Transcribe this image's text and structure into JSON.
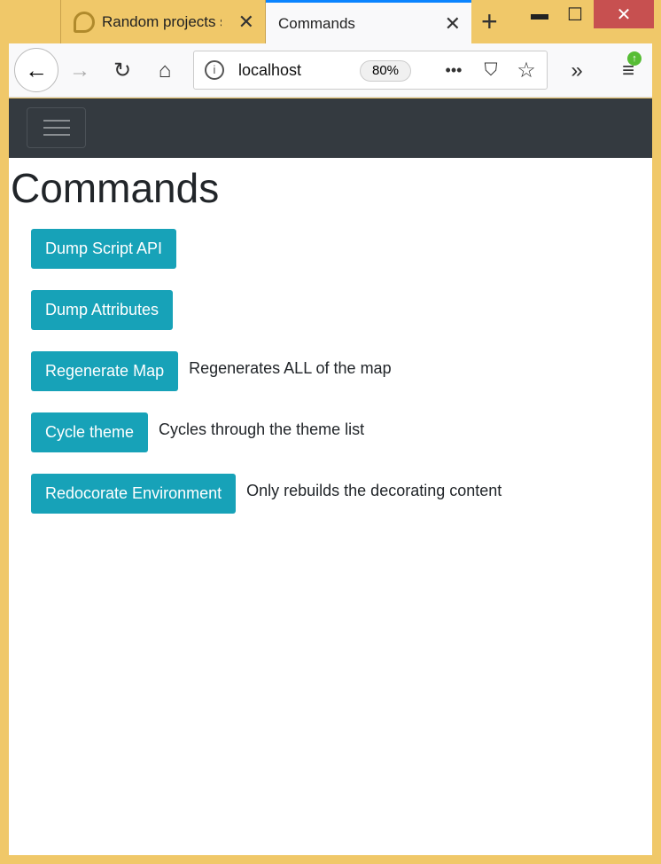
{
  "browser": {
    "tabs": [
      {
        "title": "Random projects s",
        "active": false
      },
      {
        "title": "Commands",
        "active": true
      }
    ],
    "url": "localhost",
    "zoom": "80%",
    "accent": "#0a84ff"
  },
  "page": {
    "title": "Commands",
    "commands": [
      {
        "label": "Dump Script API",
        "description": ""
      },
      {
        "label": "Dump Attributes",
        "description": ""
      },
      {
        "label": "Regenerate Map",
        "description": "Regenerates ALL of the map"
      },
      {
        "label": "Cycle theme",
        "description": "Cycles through the theme list"
      },
      {
        "label": "Redocorate Environment",
        "description": "Only rebuilds the decorating content"
      }
    ],
    "button_color": "#17a2b8"
  }
}
